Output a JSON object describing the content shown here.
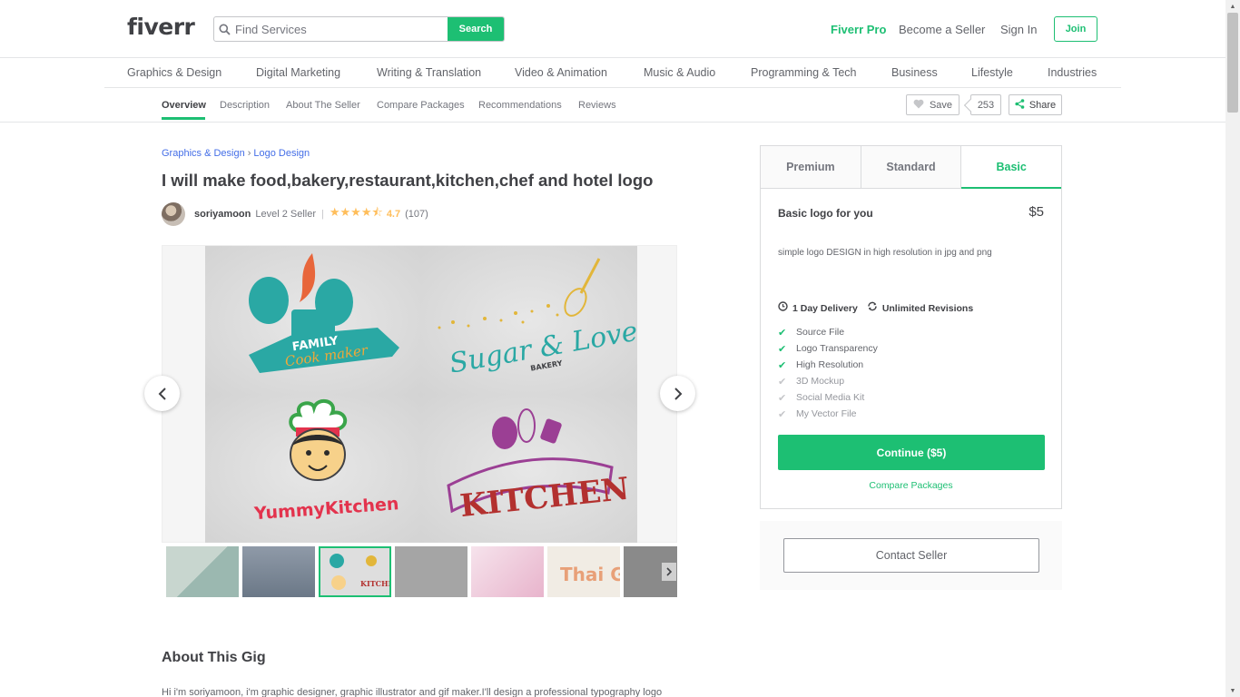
{
  "header": {
    "logo": "fiverr",
    "search_placeholder": "Find Services",
    "search_button": "Search",
    "fiverr_pro": "Fiverr Pro",
    "become_seller": "Become a Seller",
    "sign_in": "Sign In",
    "join": "Join"
  },
  "categories": [
    "Graphics & Design",
    "Digital Marketing",
    "Writing & Translation",
    "Video & Animation",
    "Music & Audio",
    "Programming & Tech",
    "Business",
    "Lifestyle",
    "Industries"
  ],
  "subnav": {
    "tabs": [
      "Overview",
      "Description",
      "About The Seller",
      "Compare Packages",
      "Recommendations",
      "Reviews"
    ],
    "save": "Save",
    "count": "253",
    "share": "Share"
  },
  "breadcrumb": {
    "parent": "Graphics & Design",
    "sep": "›",
    "child": "Logo Design"
  },
  "gig": {
    "title": "I will make food,bakery,restaurant,kitchen,chef and hotel logo",
    "seller_name": "soriyamoon",
    "seller_level": "Level 2 Seller",
    "stars": "★★★★⯪",
    "rating": "4.7",
    "reviews": "(107)"
  },
  "gallery": {
    "logo1_top": "FAMILY",
    "logo1_bottom": "Cook maker",
    "logo2_main": "Sugar & Love",
    "logo2_sub": "BAKERY",
    "logo3": "YummyKitchen",
    "logo4": "KITCHEN",
    "thumb6": "Thai Green"
  },
  "about": {
    "title": "About This Gig",
    "text": "Hi i'm soriyamoon, i'm graphic designer, graphic illustrator and gif maker.I'll design a professional typography logo"
  },
  "package": {
    "tabs": [
      "Premium",
      "Standard",
      "Basic"
    ],
    "name": "Basic logo for you",
    "price": "$5",
    "description": "simple logo DESIGN in high resolution in jpg and png",
    "delivery": "1 Day Delivery",
    "revisions": "Unlimited Revisions",
    "features": [
      {
        "label": "Source File",
        "included": true
      },
      {
        "label": "Logo Transparency",
        "included": true
      },
      {
        "label": "High Resolution",
        "included": true
      },
      {
        "label": "3D Mockup",
        "included": false
      },
      {
        "label": "Social Media Kit",
        "included": false
      },
      {
        "label": "My Vector File",
        "included": false
      }
    ],
    "continue": "Continue ($5)",
    "compare": "Compare Packages"
  },
  "contact": {
    "button": "Contact Seller"
  },
  "colors": {
    "brand_green": "#1dbf73",
    "link_blue": "#446ee7",
    "star_gold": "#ffbe5b"
  }
}
